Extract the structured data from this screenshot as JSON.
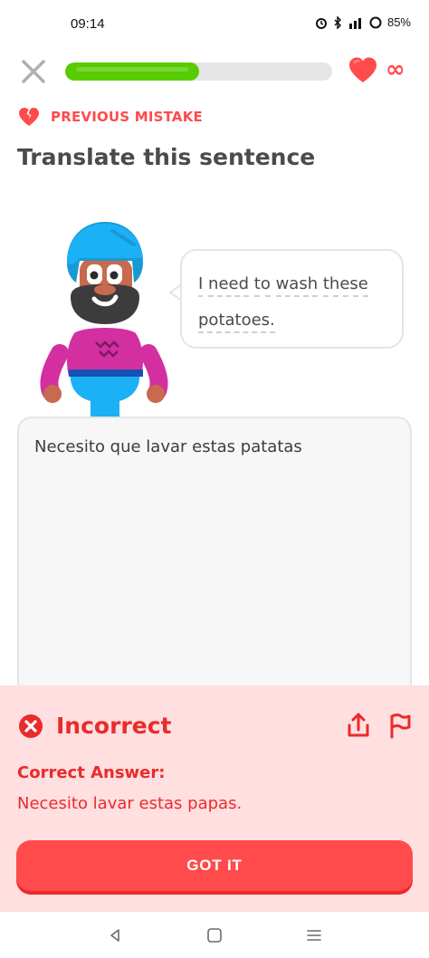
{
  "status_bar": {
    "time": "09:14",
    "battery": "85%",
    "icons": [
      "alarm-icon",
      "bluetooth-icon",
      "signal-icon",
      "battery-icon"
    ]
  },
  "lesson": {
    "progress": 0.5,
    "hearts": "∞",
    "previous_mistake_label": "PREVIOUS MISTAKE",
    "title": "Translate this sentence",
    "prompt_words": [
      "I",
      "need",
      "to",
      "wash",
      "these",
      "potatoes."
    ],
    "answer_value": "Necesito que lavar estas patatas"
  },
  "feedback": {
    "status": "Incorrect",
    "correct_answer_label": "Correct Answer:",
    "correct_answer": "Necesito lavar estas papas.",
    "button_label": "GOT IT"
  },
  "colors": {
    "accent_green": "#58cc02",
    "error_red": "#ea2b2b",
    "button_red": "#ff4b4b",
    "feedback_bg": "#ffdfe0"
  }
}
